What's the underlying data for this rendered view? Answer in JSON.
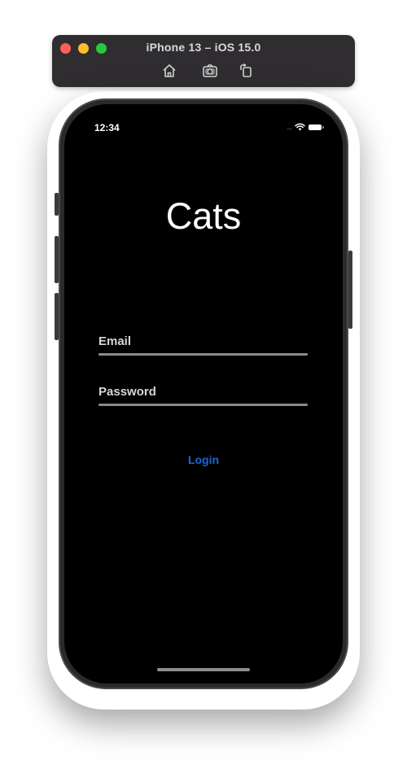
{
  "simulator": {
    "title": "iPhone 13 – iOS 15.0",
    "buttons": [
      "home-icon",
      "screenshot-icon",
      "rotate-icon"
    ]
  },
  "status_bar": {
    "time": "12:34",
    "signal": "....",
    "icons": [
      "wifi-icon",
      "battery-icon"
    ]
  },
  "app": {
    "title": "Cats",
    "email_placeholder": "Email",
    "password_placeholder": "Password",
    "login_label": "Login"
  },
  "colors": {
    "screen_background": "#000000",
    "accent": "#1f66d6",
    "underline": "#8a8a8a"
  }
}
